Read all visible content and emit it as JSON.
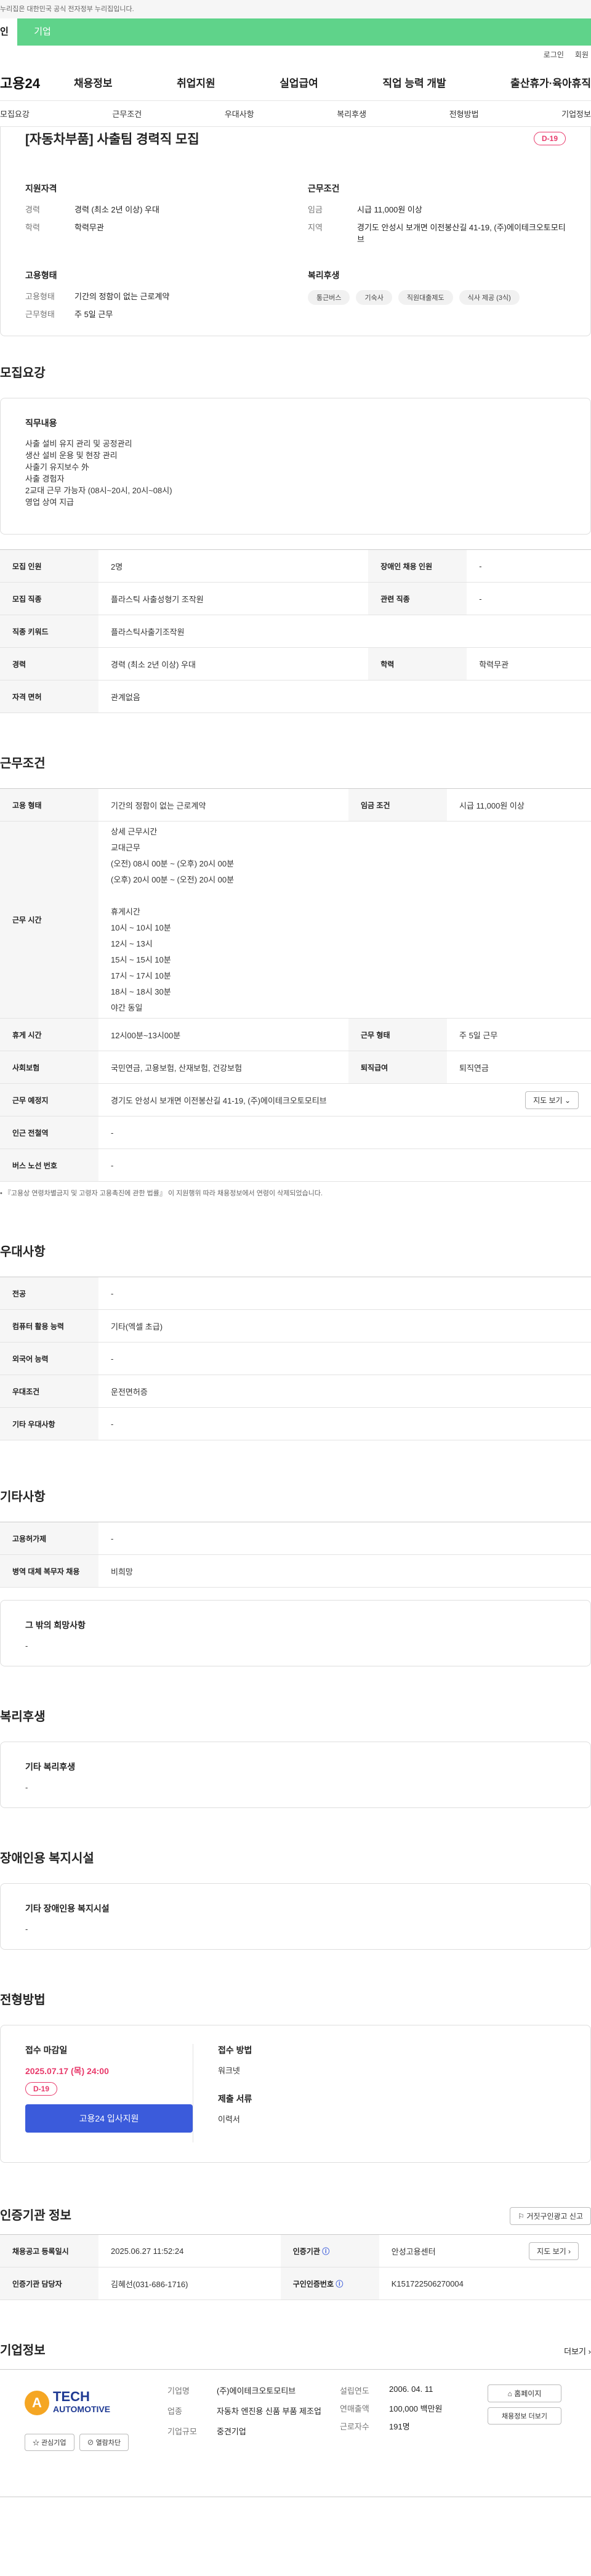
{
  "gov_bar": "누리집은 대한민국 공식 전자정부 누리집입니다.",
  "top_tabs": [
    "인",
    "기업"
  ],
  "util": [
    "로그인",
    "회원"
  ],
  "logo": "고용24",
  "gnb": [
    "채용정보",
    "취업지원",
    "실업급여",
    "직업 능력 개발",
    "출산휴가·육아휴직"
  ],
  "subnav": [
    "모집요강",
    "근무조건",
    "우대사항",
    "복리후생",
    "전형방법",
    "기업정보"
  ],
  "summary": {
    "title": "[자동차부품] 사출팀 경력직 모집",
    "dday": "D-19",
    "qual": {
      "h": "지원자격",
      "rows": [
        [
          "경력",
          "경력 (최소 2년 이상) 우대"
        ],
        [
          "학력",
          "학력무관"
        ]
      ]
    },
    "cond": {
      "h": "근무조건",
      "rows": [
        [
          "임금",
          "시급 11,000원 이상"
        ],
        [
          "지역",
          "경기도 안성시 보개면 이전봉산길 41-19, (주)에이테크오토모티브"
        ]
      ]
    },
    "emp": {
      "h": "고용형태",
      "rows": [
        [
          "고용형태",
          "기간의 정함이 없는 근로계약"
        ],
        [
          "근무형태",
          "주 5일 근무"
        ]
      ]
    },
    "welfare": {
      "h": "복리후생",
      "tags": [
        "통근버스",
        "기숙사",
        "직원대출제도",
        "식사 제공 (3식)"
      ]
    }
  },
  "recruit": {
    "title": "모집요강",
    "duty_h": "직무내용",
    "duty": "사출 설비 유지 관리 및 공정관리\n생산 설비 운용 및 현장 관리\n사출기 유지보수 外\n사출 경험자\n2교대 근무 가능자 (08시~20시, 20시~08시)\n영업 상여 지급",
    "rows": [
      [
        "모집 인원",
        "2명",
        "장애인 채용 인원",
        "-"
      ],
      [
        "모집 직종",
        "플라스틱 사출성형기 조작원",
        "관련 직종",
        "-"
      ],
      [
        "직종 키워드",
        "플라스틱사출기조작원",
        "",
        ""
      ],
      [
        "경력",
        "경력 (최소 2년 이상) 우대",
        "학력",
        "학력무관"
      ],
      [
        "자격 면허",
        "관계없음",
        "",
        ""
      ]
    ]
  },
  "work": {
    "title": "근무조건",
    "emp_h": "고용 형태",
    "emp_v": "기간의 정함이 없는 근로계약",
    "wage_h": "임금 조건",
    "wage_v": "시급 11,000원 이상",
    "time_h": "근무 시간",
    "time_v": "상세 근무시간\n교대근무\n(오전) 08시 00분 ~ (오후) 20시 00분\n(오후) 20시 00분 ~ (오전) 20시 00분\n\n휴게시간\n10시 ~ 10시 10분\n12시 ~ 13시\n15시 ~ 15시 10분\n17시 ~ 17시 10분\n18시 ~ 18시 30분\n야간 동일",
    "break_h": "휴게 시간",
    "break_v": "12시00분~13시00분",
    "shift_h": "근무 형태",
    "shift_v": "주 5일 근무",
    "ins_h": "사회보험",
    "ins_v": "국민연금, 고용보험, 산재보험, 건강보험",
    "ret_h": "퇴직급여",
    "ret_v": "퇴직연금",
    "loc_h": "근무 예정지",
    "loc_v": "경기도 안성시 보개면 이전봉산길 41-19, (주)에이테크오토모티브",
    "map_btn": "지도 보기",
    "sub_h": "인근 전철역",
    "sub_v": "-",
    "bus_h": "버스 노선 번호",
    "bus_v": "-",
    "note": "『고용상 연령차별금지 및 고령자 고용촉진에 관한 법률』 이 지원행위 따라 채용정보에서 연령이 삭제되었습니다."
  },
  "pref": {
    "title": "우대사항",
    "rows": [
      [
        "전공",
        "-"
      ],
      [
        "컴퓨터 활용 능력",
        "기타(엑셀 초급)"
      ],
      [
        "외국어 능력",
        "-"
      ],
      [
        "우대조건",
        "운전면허증"
      ],
      [
        "기타 우대사항",
        "-"
      ]
    ]
  },
  "etc": {
    "title": "기타사항",
    "rows": [
      [
        "고용허가제",
        "-"
      ],
      [
        "병역 대체 복무자 채용",
        "비희망"
      ]
    ],
    "box_h": "그 밖의 희망사항",
    "box_v": "-"
  },
  "benefit": {
    "title": "복리후생",
    "box_h": "기타 복리후생",
    "box_v": "-"
  },
  "disab": {
    "title": "장애인용 복지시설",
    "box_h": "기타 장애인용 복지시설",
    "box_v": "-"
  },
  "apply": {
    "title": "전형방법",
    "deadline_h": "접수 마감일",
    "deadline_v": "2025.07.17 (목) 24:00",
    "dday": "D-19",
    "apply_btn": "고용24 입사지원",
    "method_h": "접수 방법",
    "method_v": "워크넷",
    "docs_h": "제출 서류",
    "docs_v": "이력서"
  },
  "cert": {
    "title": "인증기관 정보",
    "report_btn": "거짓구인광고 신고",
    "rows": [
      [
        "채용공고 등록일시",
        "2025.06.27 11:52:24",
        "인증기관",
        "안성고용센터"
      ],
      [
        "인증기관 담당자",
        "김혜선(031-686-1716)",
        "구인인증번호",
        "K151722506270004"
      ]
    ],
    "map_btn": "지도 보기"
  },
  "company": {
    "title": "기업정보",
    "more": "더보기",
    "logo_top": "TECH",
    "logo_bottom": "AUTOMOTIVE",
    "interest": "관심기업",
    "block": "열람차단",
    "name_h": "기업명",
    "name_v": "(주)에이테크오토모티브",
    "ind_h": "업종",
    "ind_v": "자동차 엔진용 신품 부품 제조업",
    "size_h": "기업규모",
    "size_v": "중견기업",
    "est_h": "설립연도",
    "est_v": "2006. 04. 11",
    "sales_h": "연매출액",
    "sales_v": "100,000 백만원",
    "emp_h": "근로자수",
    "emp_v": "191명",
    "homepage": "홈페이지",
    "jobs": "채용정보 더보기"
  }
}
